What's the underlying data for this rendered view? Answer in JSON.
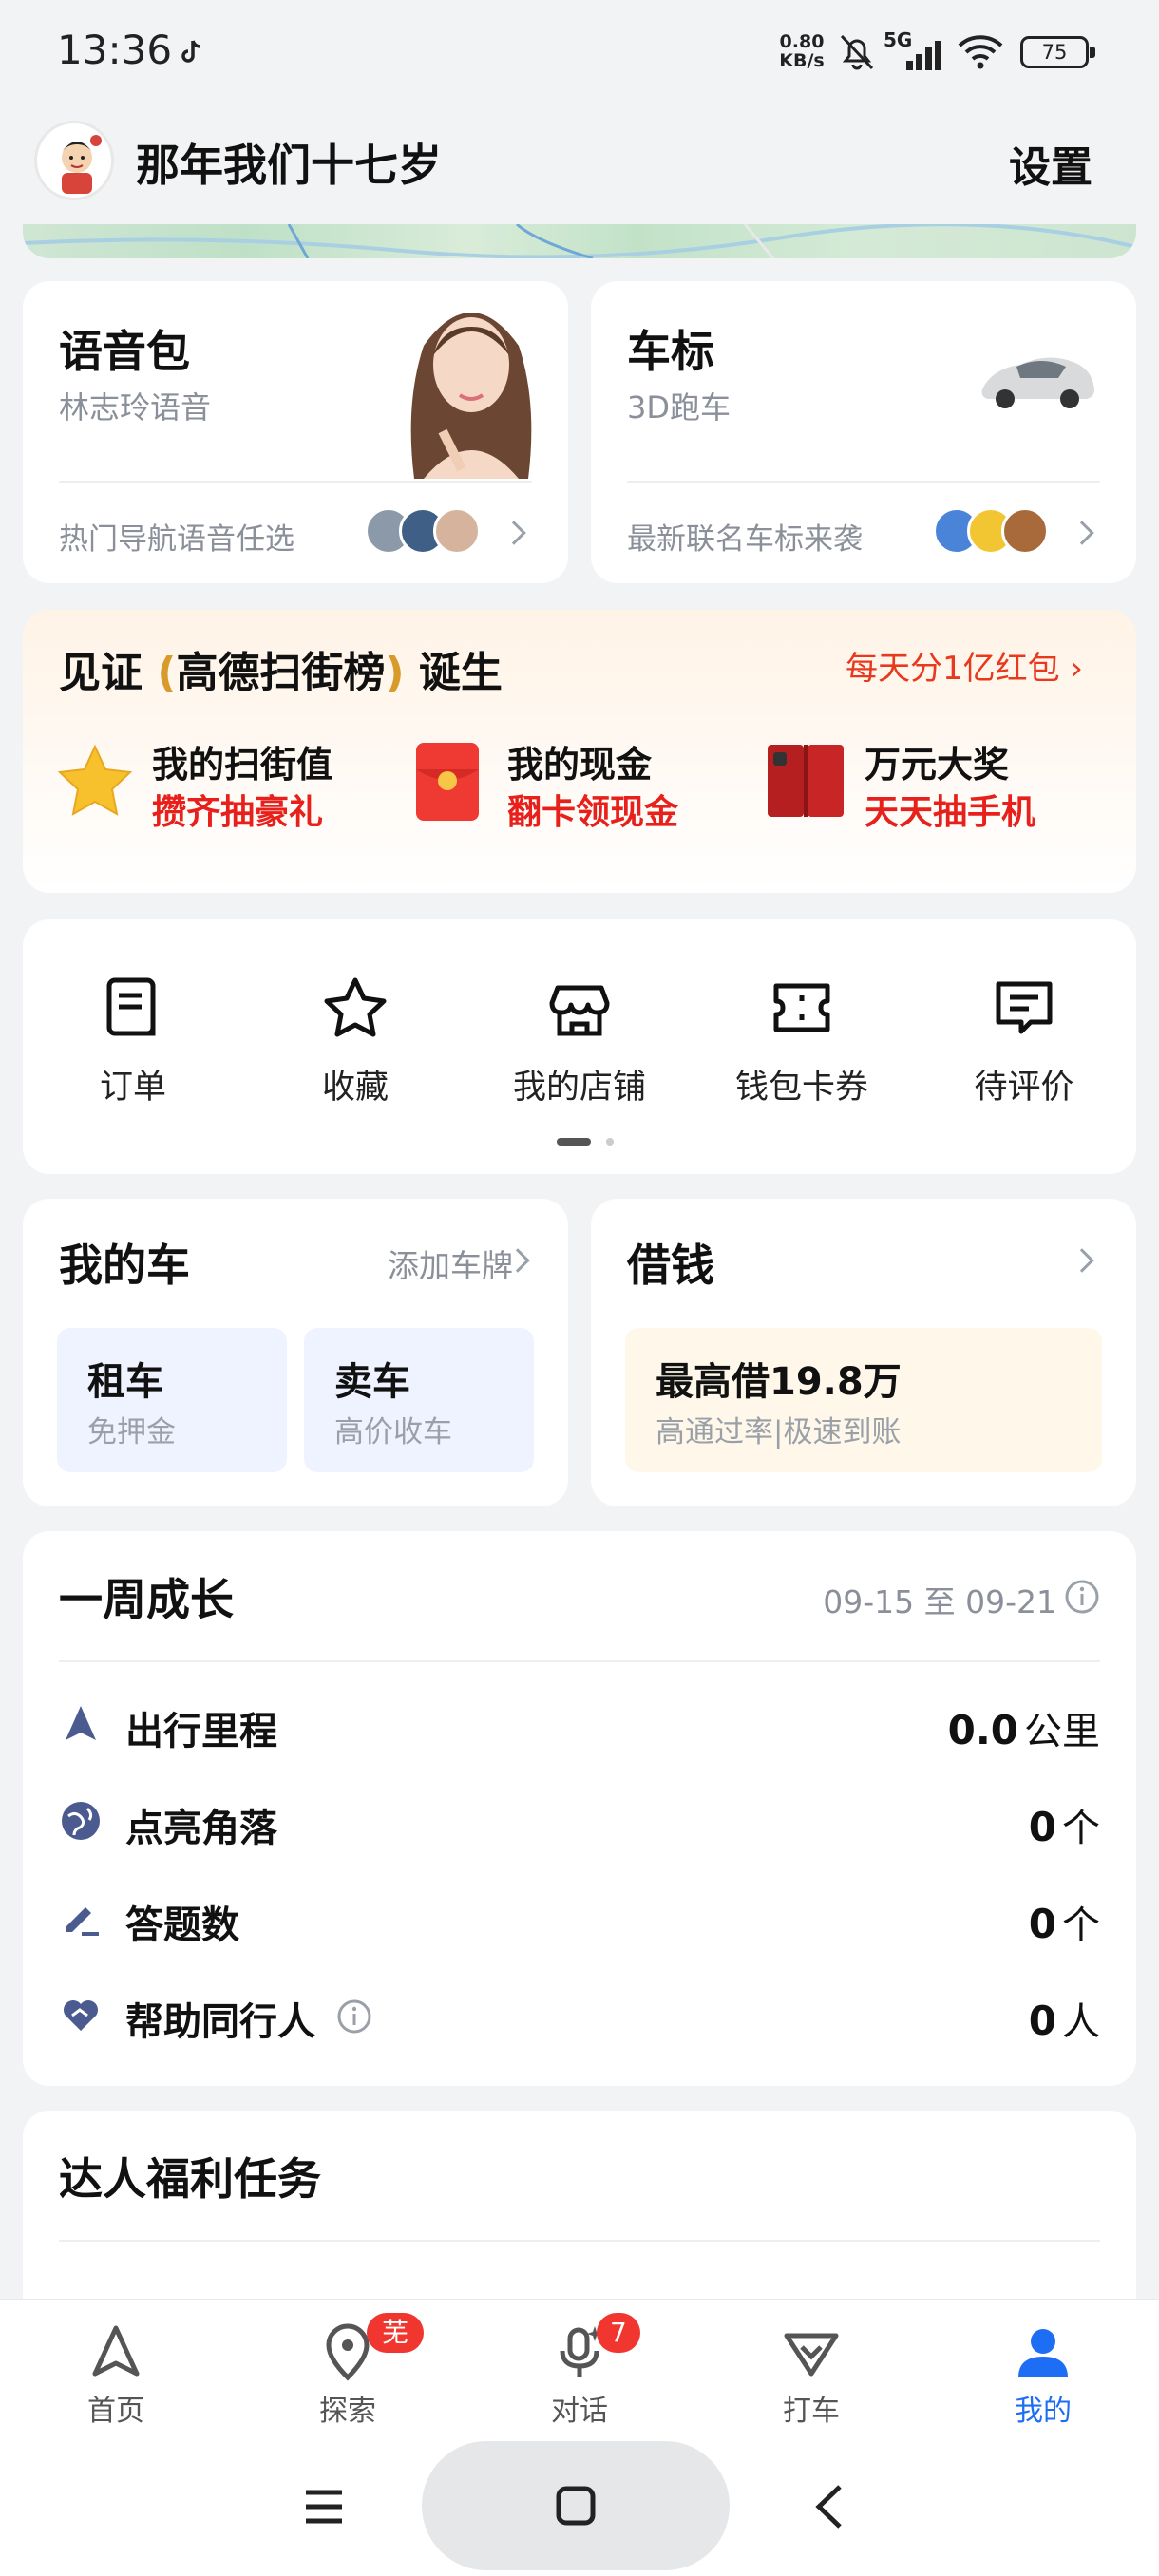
{
  "status_bar": {
    "time": "13:36",
    "net_speed_value": "0.80",
    "net_speed_unit": "KB/s",
    "signal_label": "5G",
    "battery": "75"
  },
  "header": {
    "username": "那年我们十七岁",
    "settings_label": "设置"
  },
  "voice_pack": {
    "title": "语音包",
    "subtitle": "林志玲语音",
    "footer": "热门导航语音任选"
  },
  "car_logo": {
    "title": "车标",
    "subtitle": "3D跑车",
    "footer": "最新联名车标来袭"
  },
  "promo": {
    "title_prefix": "见证",
    "title_brand": "高德扫街榜",
    "title_suffix": "诞生",
    "link": "每天分1亿红包",
    "items": [
      {
        "title": "我的扫街值",
        "sub": "攒齐抽豪礼"
      },
      {
        "title": "我的现金",
        "sub": "翻卡领现金"
      },
      {
        "title": "万元大奖",
        "sub": "天天抽手机"
      }
    ]
  },
  "shortcuts": [
    {
      "label": "订单"
    },
    {
      "label": "收藏"
    },
    {
      "label": "我的店铺"
    },
    {
      "label": "钱包卡券"
    },
    {
      "label": "待评价"
    }
  ],
  "my_car": {
    "title": "我的车",
    "add_plate": "添加车牌",
    "tiles": [
      {
        "title": "租车",
        "sub": "免押金"
      },
      {
        "title": "卖车",
        "sub": "高价收车"
      }
    ]
  },
  "loan": {
    "title": "借钱",
    "tile_title": "最高借19.8万",
    "tile_sub": "高通过率|极速到账"
  },
  "weekly_growth": {
    "title": "一周成长",
    "date_range": "09-15 至 09-21",
    "rows": [
      {
        "label": "出行里程",
        "value": "0.0",
        "unit": "公里"
      },
      {
        "label": "点亮角落",
        "value": "0",
        "unit": "个"
      },
      {
        "label": "答题数",
        "value": "0",
        "unit": "个"
      },
      {
        "label": "帮助同行人",
        "value": "0",
        "unit": "人"
      }
    ]
  },
  "expert_tasks": {
    "title": "达人福利任务"
  },
  "bottom_nav": {
    "items": [
      {
        "label": "首页"
      },
      {
        "label": "探索",
        "badge": "芜湖"
      },
      {
        "label": "对话",
        "badge": "7"
      },
      {
        "label": "打车"
      },
      {
        "label": "我的"
      }
    ],
    "active_color": "#1e6ef5"
  }
}
